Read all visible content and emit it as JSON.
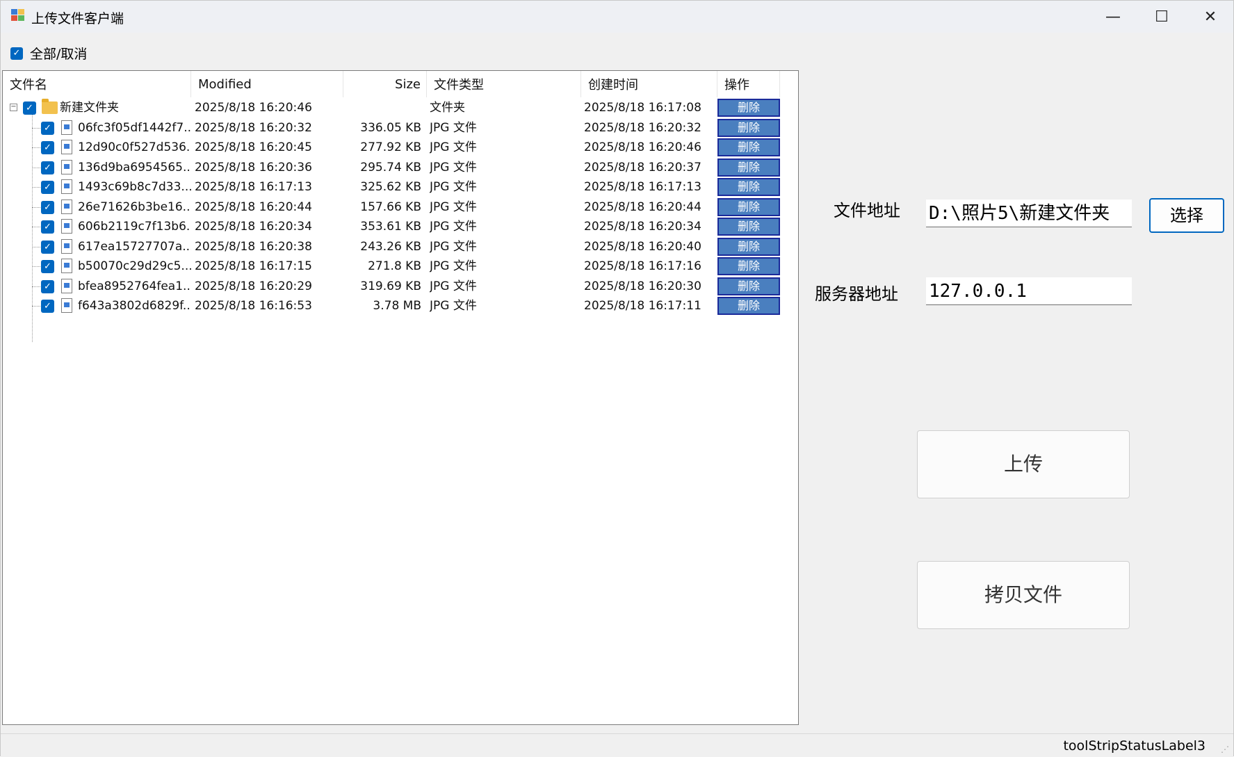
{
  "window": {
    "title": "上传文件客户端",
    "minimize_glyph": "—",
    "maximize_glyph": "☐",
    "close_glyph": "✕"
  },
  "select_all": {
    "label": "全部/取消",
    "checked": true
  },
  "tree": {
    "columns": [
      "文件名",
      "Modified",
      "Size",
      "文件类型",
      "创建时间",
      "操作"
    ],
    "folder": {
      "name": "新建文件夹",
      "modified": "2025/8/18 16:20:46",
      "size": "",
      "type": "文件夹",
      "created": "2025/8/18 16:17:08",
      "action": "删除"
    },
    "files": [
      {
        "name": "06fc3f05df1442f7...",
        "modified": "2025/8/18 16:20:32",
        "size": "336.05 KB",
        "type": "JPG 文件",
        "created": "2025/8/18 16:20:32",
        "action": "删除"
      },
      {
        "name": "12d90c0f527d536...",
        "modified": "2025/8/18 16:20:45",
        "size": "277.92 KB",
        "type": "JPG 文件",
        "created": "2025/8/18 16:20:46",
        "action": "删除"
      },
      {
        "name": "136d9ba6954565...",
        "modified": "2025/8/18 16:20:36",
        "size": "295.74 KB",
        "type": "JPG 文件",
        "created": "2025/8/18 16:20:37",
        "action": "删除"
      },
      {
        "name": "1493c69b8c7d33...",
        "modified": "2025/8/18 16:17:13",
        "size": "325.62 KB",
        "type": "JPG 文件",
        "created": "2025/8/18 16:17:13",
        "action": "删除"
      },
      {
        "name": "26e71626b3be16...",
        "modified": "2025/8/18 16:20:44",
        "size": "157.66 KB",
        "type": "JPG 文件",
        "created": "2025/8/18 16:20:44",
        "action": "删除"
      },
      {
        "name": "606b2119c7f13b6...",
        "modified": "2025/8/18 16:20:34",
        "size": "353.61 KB",
        "type": "JPG 文件",
        "created": "2025/8/18 16:20:34",
        "action": "删除"
      },
      {
        "name": "617ea15727707a...",
        "modified": "2025/8/18 16:20:38",
        "size": "243.26 KB",
        "type": "JPG 文件",
        "created": "2025/8/18 16:20:40",
        "action": "删除"
      },
      {
        "name": "b50070c29d29c5...",
        "modified": "2025/8/18 16:17:15",
        "size": "271.8 KB",
        "type": "JPG 文件",
        "created": "2025/8/18 16:17:16",
        "action": "删除"
      },
      {
        "name": "bfea8952764fea1...",
        "modified": "2025/8/18 16:20:29",
        "size": "319.69 KB",
        "type": "JPG 文件",
        "created": "2025/8/18 16:20:30",
        "action": "删除"
      },
      {
        "name": "f643a3802d6829f...",
        "modified": "2025/8/18 16:16:53",
        "size": "3.78 MB",
        "type": "JPG 文件",
        "created": "2025/8/18 16:17:11",
        "action": "删除"
      }
    ]
  },
  "form": {
    "file_path_label": "文件地址",
    "file_path_value": "D:\\照片5\\新建文件夹",
    "choose_button": "选择",
    "server_label": "服务器地址",
    "server_value": "127.0.0.1",
    "upload_button": "上传",
    "copy_button": "拷贝文件"
  },
  "status": {
    "text": "toolStripStatusLabel3"
  },
  "colors": {
    "accent": "#0067c0",
    "delete_button": "#4a7fbf",
    "delete_border": "#1a2a9a"
  }
}
